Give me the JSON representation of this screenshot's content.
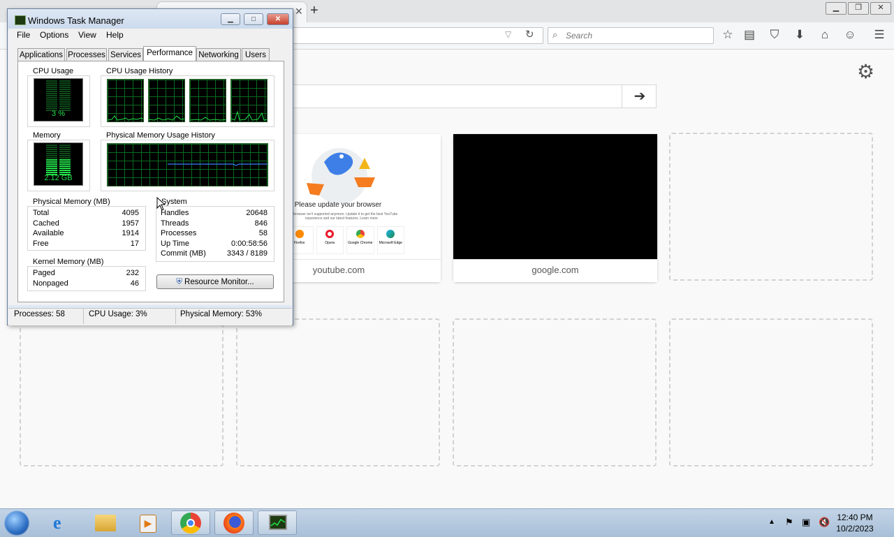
{
  "firefox": {
    "search_placeholder": "Search",
    "tiles": [
      {
        "label": "youtube.com"
      },
      {
        "label": "google.com"
      }
    ],
    "youtube_preview": {
      "heading": "Please update your browser",
      "subtext": "Your browser isn't supported anymore. Update it to get the best YouTube experience and our latest features. Learn more",
      "browsers": [
        "Firefox",
        "Opera",
        "Google Chrome",
        "Microsoft Edge"
      ]
    }
  },
  "taskmgr": {
    "title": "Windows Task Manager",
    "menu": [
      "File",
      "Options",
      "View",
      "Help"
    ],
    "tabs": [
      "Applications",
      "Processes",
      "Services",
      "Performance",
      "Networking",
      "Users"
    ],
    "active_tab": "Performance",
    "cpu_usage_label": "CPU Usage",
    "cpu_usage_value": "3 %",
    "cpu_usage_fraction": 0.03,
    "cpu_history_label": "CPU Usage History",
    "memory_label": "Memory",
    "memory_value": "2.12 GB",
    "memory_fraction": 0.53,
    "phys_history_label": "Physical Memory Usage History",
    "physical_memory": {
      "label": "Physical Memory (MB)",
      "rows": [
        {
          "k": "Total",
          "v": "4095"
        },
        {
          "k": "Cached",
          "v": "1957"
        },
        {
          "k": "Available",
          "v": "1914"
        },
        {
          "k": "Free",
          "v": "17"
        }
      ]
    },
    "kernel_memory": {
      "label": "Kernel Memory (MB)",
      "rows": [
        {
          "k": "Paged",
          "v": "232"
        },
        {
          "k": "Nonpaged",
          "v": "46"
        }
      ]
    },
    "system": {
      "label": "System",
      "rows": [
        {
          "k": "Handles",
          "v": "20648"
        },
        {
          "k": "Threads",
          "v": "846"
        },
        {
          "k": "Processes",
          "v": "58"
        },
        {
          "k": "Up Time",
          "v": "0:00:58:56"
        },
        {
          "k": "Commit (MB)",
          "v": "3343 / 8189"
        }
      ]
    },
    "resource_monitor_label": "Resource Monitor...",
    "status": {
      "processes": "Processes: 58",
      "cpu": "CPU Usage: 3%",
      "memory": "Physical Memory: 53%"
    }
  },
  "taskbar": {
    "time": "12:40 PM",
    "date": "10/2/2023"
  },
  "colors": {
    "graph_green": "#22e04a",
    "graph_grid": "#0b6b1f",
    "memory_line": "#3a7bff",
    "close_red": "#c5412c"
  }
}
